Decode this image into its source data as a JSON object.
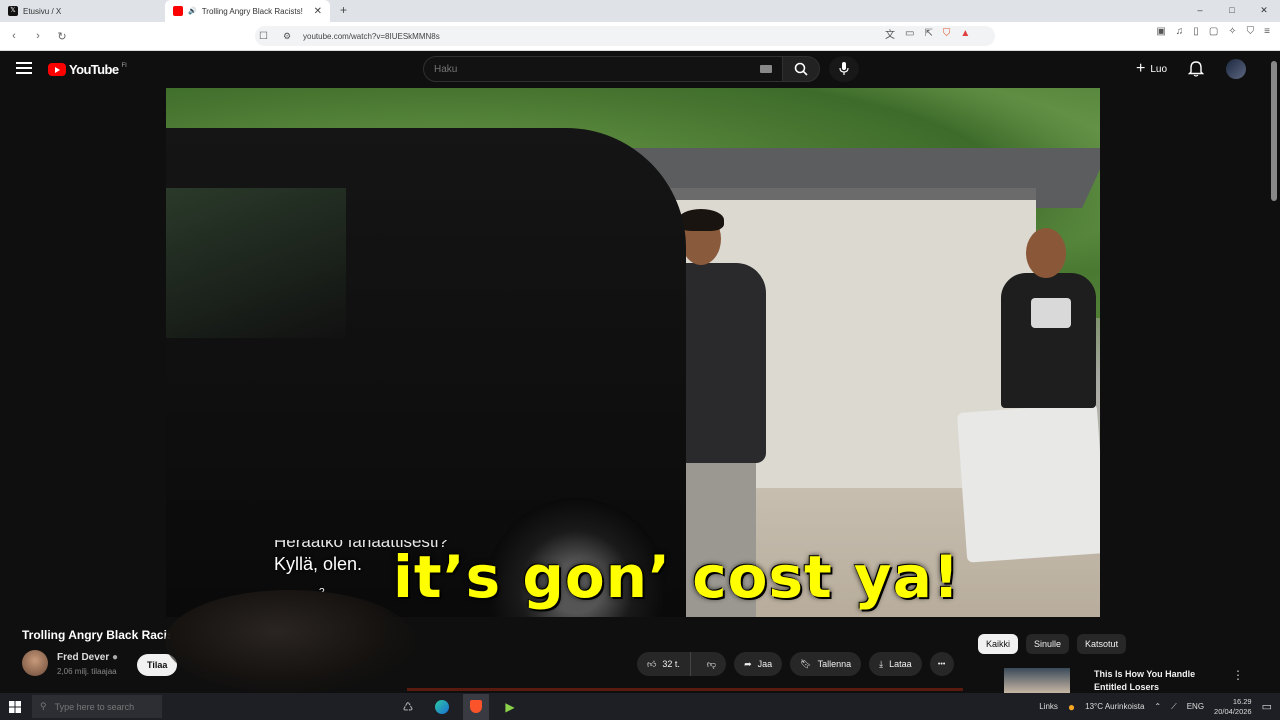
{
  "browser": {
    "tabs": [
      {
        "label": "Etusivu / X",
        "active": false
      },
      {
        "label": "Trolling Angry Black Racists!",
        "active": true
      }
    ],
    "new_tab": "+",
    "window_controls": {
      "minimize": "–",
      "maximize": "□",
      "close": "✕"
    },
    "url": "youtube.com/watch?v=8IUESkMMN8s"
  },
  "youtube": {
    "logo": "YouTube",
    "country": "FI",
    "search_placeholder": "Haku",
    "create_label": "Luo"
  },
  "video": {
    "subtitle_partial": "Heräätkö fanaattisesti?",
    "subtitle_line": "Kyllä, olen.",
    "subtitle_extra": "?",
    "caption": "it’s gon’ cost ya!"
  },
  "below": {
    "title": "Trolling Angry Black Racists!",
    "channel_name": "Fred Dever",
    "subscribers": "2,06 milj. tilaajaa",
    "subscribe_label": "Tilaa",
    "likes": "32 t.",
    "share_label": "Jaa",
    "save_label": "Tallenna",
    "download_label": "Lataa",
    "more": "•••"
  },
  "sidebar": {
    "chips": [
      {
        "label": "Kaikki",
        "active": true
      },
      {
        "label": "Sinulle",
        "active": false
      },
      {
        "label": "Katsotut",
        "active": false
      }
    ],
    "rec_title": "This Is How You Handle Entitled Losers",
    "rec_menu": "⋮"
  },
  "taskbar": {
    "search_placeholder": "Type here to search",
    "links": "Links",
    "weather": "13°C  Aurinkoista",
    "lang": "ENG",
    "time": "16.29",
    "date": "20/04/2026"
  },
  "colors": {
    "youtube_red": "#ff0000",
    "caption_yellow": "#ffff00",
    "bg": "#0f0f0f"
  }
}
